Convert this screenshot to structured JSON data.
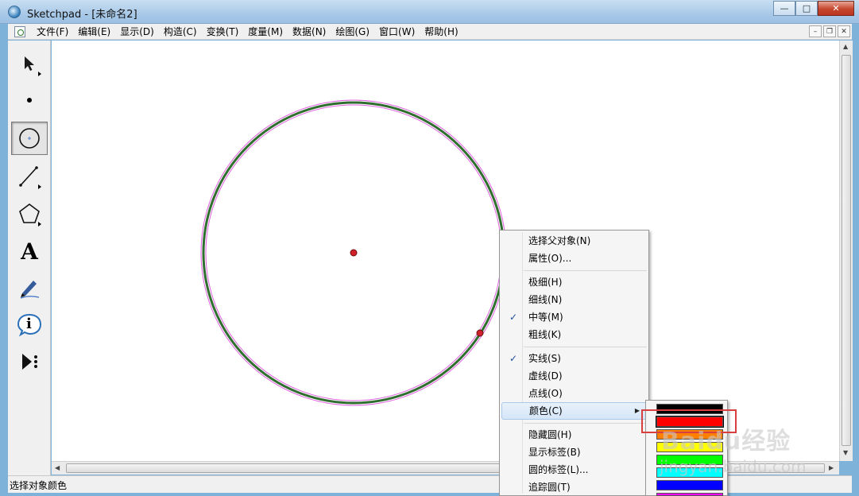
{
  "window": {
    "title": "Sketchpad  - [未命名2]",
    "minimize": "—",
    "maximize": "□",
    "close": "✕"
  },
  "menubar": {
    "items": [
      "文件(F)",
      "编辑(E)",
      "显示(D)",
      "构造(C)",
      "变换(T)",
      "度量(M)",
      "数据(N)",
      "绘图(G)",
      "窗口(W)",
      "帮助(H)"
    ],
    "mdi_minimize": "–",
    "mdi_restore": "❐",
    "mdi_close": "✕"
  },
  "toolbox": {
    "tools": [
      "arrow-select-icon",
      "point-icon",
      "compass-circle-icon",
      "straightedge-icon",
      "polygon-icon",
      "text-icon",
      "marker-icon",
      "information-icon",
      "custom-tools-icon"
    ],
    "text_tool_glyph": "A",
    "info_tool_glyph": "i",
    "active_tool": "compass-circle-icon"
  },
  "canvas": {
    "circle_color": "#2f6e2f",
    "selection_color": "#e060e0",
    "point_color": "#d0202a"
  },
  "context_menu": {
    "items": [
      {
        "label": "选择父对象(N)",
        "checked": false
      },
      {
        "label": "属性(O)...",
        "checked": false
      },
      {
        "label": "极细(H)",
        "checked": false
      },
      {
        "label": "细线(N)",
        "checked": false
      },
      {
        "label": "中等(M)",
        "checked": true
      },
      {
        "label": "粗线(K)",
        "checked": false
      },
      {
        "label": "实线(S)",
        "checked": true
      },
      {
        "label": "虚线(D)",
        "checked": false
      },
      {
        "label": "点线(O)",
        "checked": false
      },
      {
        "label": "颜色(C)",
        "checked": false,
        "submenu": true,
        "highlighted": true
      },
      {
        "label": "隐藏圆(H)",
        "checked": false
      },
      {
        "label": "显示标签(B)",
        "checked": false
      },
      {
        "label": "圆的标签(L)...",
        "checked": false
      },
      {
        "label": "追踪圆(T)",
        "checked": false
      }
    ],
    "check_glyph": "✓",
    "submenu_glyph": "▶"
  },
  "color_submenu": {
    "swatches": [
      "#000000",
      "#ff0000",
      "#ff8000",
      "#ffff00",
      "#00ff00",
      "#00ffff",
      "#0000ff",
      "#ff00ff"
    ],
    "highlighted_index": 1
  },
  "statusbar": {
    "text": "选择对象颜色"
  },
  "watermark": {
    "text": "Baidu经验",
    "url": "jingyan.baidu.com"
  }
}
